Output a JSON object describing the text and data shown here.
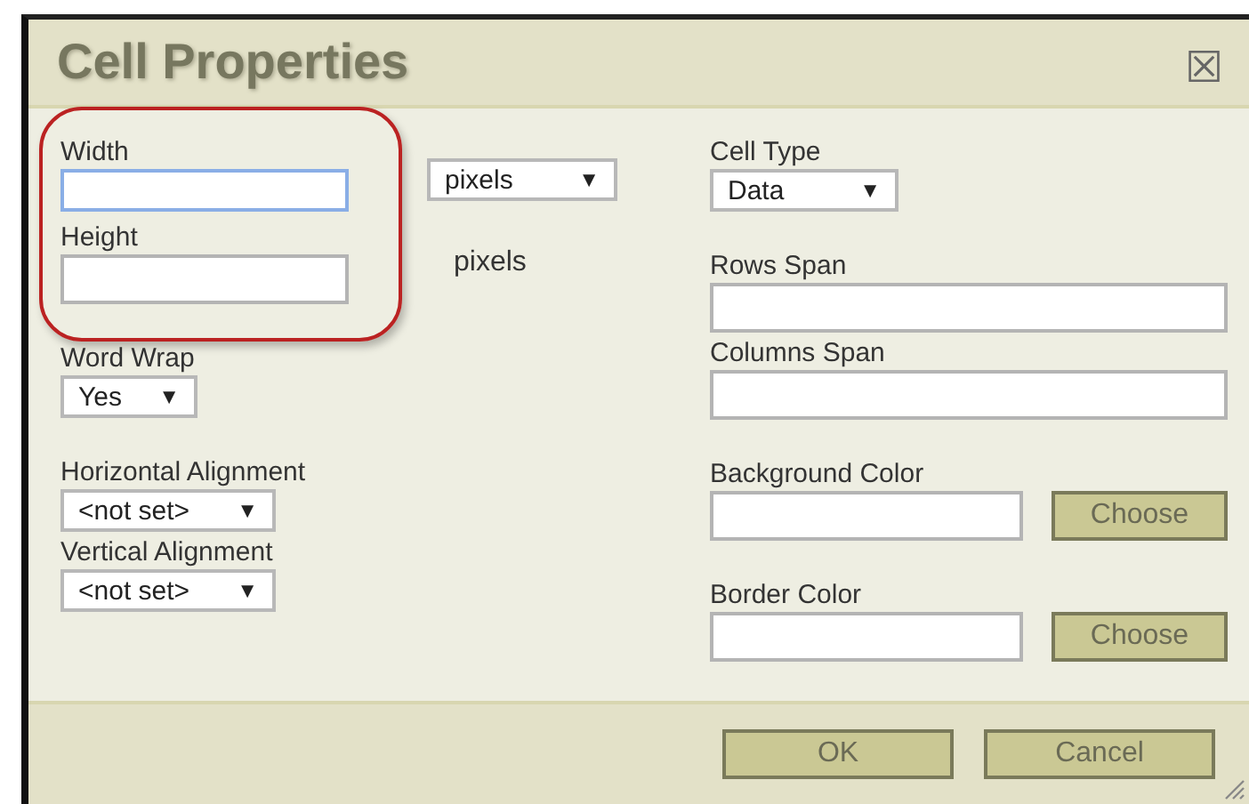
{
  "dialog": {
    "title": "Cell Properties",
    "close": "☒"
  },
  "highlight_ring": true,
  "width": {
    "label": "Width",
    "focused": true
  },
  "unit_select": {
    "value": "pixels",
    "arrow": "▼"
  },
  "height": {
    "label": "Height",
    "focused": false
  },
  "height_unit": "pixels",
  "word_wrap": {
    "label": "Word Wrap",
    "value": "Yes",
    "arrow": "▼"
  },
  "horizontal_alignment": {
    "label": "Horizontal Alignment",
    "value": "<not set>",
    "arrow": "▼"
  },
  "vertical_alignment": {
    "label": "Vertical Alignment",
    "value": "<not set>",
    "arrow": "▼"
  },
  "cell_type": {
    "label": "Cell Type",
    "value": "Data",
    "arrow": "▼"
  },
  "rows_span": {
    "label": "Rows Span"
  },
  "columns_span": {
    "label": "Columns Span"
  },
  "background_color": {
    "label": "Background Color",
    "button": "Choose"
  },
  "border_color": {
    "label": "Border Color",
    "button": "Choose"
  },
  "buttons": [
    "OK",
    "Cancel"
  ]
}
